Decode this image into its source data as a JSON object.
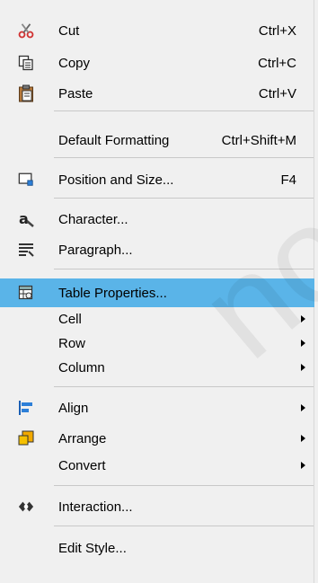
{
  "menu": {
    "items": [
      {
        "label": "Cut",
        "shortcut": "Ctrl+X",
        "icon": "scissors-icon"
      },
      {
        "label": "Copy",
        "shortcut": "Ctrl+C",
        "icon": "copy-icon"
      },
      {
        "label": "Paste",
        "shortcut": "Ctrl+V",
        "icon": "paste-icon"
      },
      {
        "label": "Default Formatting",
        "shortcut": "Ctrl+Shift+M"
      },
      {
        "label": "Position and Size...",
        "shortcut": "F4",
        "icon": "position-size-icon"
      },
      {
        "label": "Character...",
        "icon": "character-icon"
      },
      {
        "label": "Paragraph...",
        "icon": "paragraph-icon"
      },
      {
        "label": "Table Properties...",
        "icon": "table-properties-icon",
        "highlighted": true
      },
      {
        "label": "Cell",
        "submenu": true
      },
      {
        "label": "Row",
        "submenu": true
      },
      {
        "label": "Column",
        "submenu": true
      },
      {
        "label": "Align",
        "submenu": true,
        "icon": "align-icon"
      },
      {
        "label": "Arrange",
        "submenu": true,
        "icon": "arrange-icon"
      },
      {
        "label": "Convert",
        "submenu": true
      },
      {
        "label": "Interaction...",
        "icon": "interaction-icon"
      },
      {
        "label": "Edit Style..."
      }
    ]
  },
  "watermark": "not",
  "colors": {
    "highlight": "#5ab4e8",
    "background": "#f0f0f0"
  }
}
